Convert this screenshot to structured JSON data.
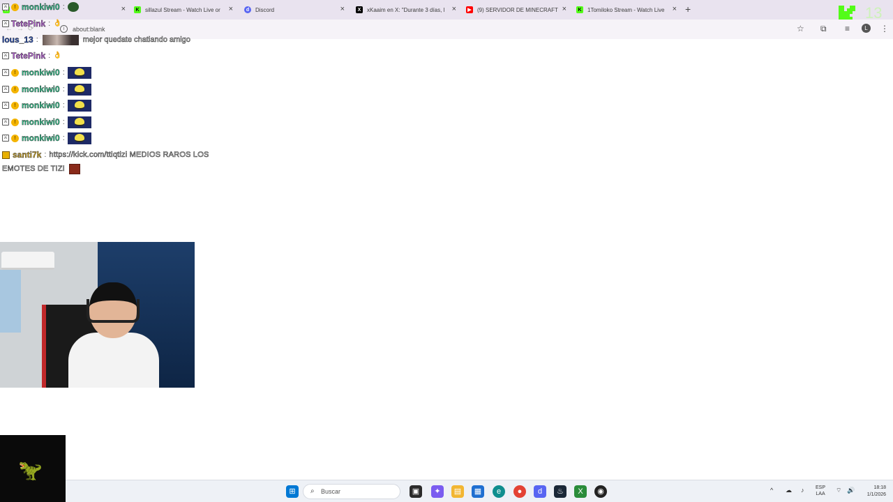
{
  "browser": {
    "tabs": [
      {
        "title": "",
        "icon": "kick-icon",
        "color": "#53fc18"
      },
      {
        "title": "sillazul Stream - Watch Live or",
        "icon": "kick-icon",
        "color": "#53fc18"
      },
      {
        "title": "Discord",
        "icon": "discord-icon",
        "color": "#5865f2"
      },
      {
        "title": "xKaaim en X: \"Durante 3 días, l",
        "icon": "x-icon",
        "color": "#000000"
      },
      {
        "title": "(9) SERVIDOR DE MINECRAFT",
        "icon": "youtube-icon",
        "color": "#ff0000"
      },
      {
        "title": "1Tomiloko Stream - Watch Live",
        "icon": "kick-icon",
        "color": "#53fc18"
      }
    ],
    "url": "about:blank",
    "profile_initial": "L",
    "watermark": "13"
  },
  "chat": {
    "messages": [
      {
        "user": "monkiwi0",
        "color": "#35c58f",
        "badges": [
          "mod",
          "sub"
        ],
        "type": "emote"
      },
      {
        "user": "TetePink",
        "color": "#b45fd3",
        "badges": [
          "mod"
        ],
        "type": "small-emote"
      },
      {
        "user": "lous_13",
        "color": "#2a4fb0",
        "badges": [],
        "type": "image",
        "text": "mejor quedate chatiando amigo"
      },
      {
        "user": "TetePink",
        "color": "#b45fd3",
        "badges": [
          "mod"
        ],
        "type": "small-emote"
      },
      {
        "user": "monkiwi0",
        "color": "#35c58f",
        "badges": [
          "mod",
          "sub"
        ],
        "type": "emote"
      },
      {
        "user": "monkiwi0",
        "color": "#35c58f",
        "badges": [
          "mod",
          "sub"
        ],
        "type": "emote"
      },
      {
        "user": "monkiwi0",
        "color": "#35c58f",
        "badges": [
          "mod",
          "sub"
        ],
        "type": "emote"
      },
      {
        "user": "monkiwi0",
        "color": "#35c58f",
        "badges": [
          "mod",
          "sub"
        ],
        "type": "emote"
      },
      {
        "user": "monkiwi0",
        "color": "#35c58f",
        "badges": [
          "mod",
          "sub"
        ],
        "type": "emote"
      },
      {
        "user": "santi7k",
        "color": "#c9a227",
        "badges": [
          "gift"
        ],
        "type": "text",
        "text": "https://kick.com/ttiqtizi MEDIOS RAROS LOS",
        "text2": "EMOTES DE TIZI"
      }
    ],
    "separator": ":"
  },
  "taskbar": {
    "search_placeholder": "Buscar",
    "lang_line1": "ESP",
    "lang_line2": "LAA",
    "time": "18:18",
    "date": "1/1/2026"
  }
}
